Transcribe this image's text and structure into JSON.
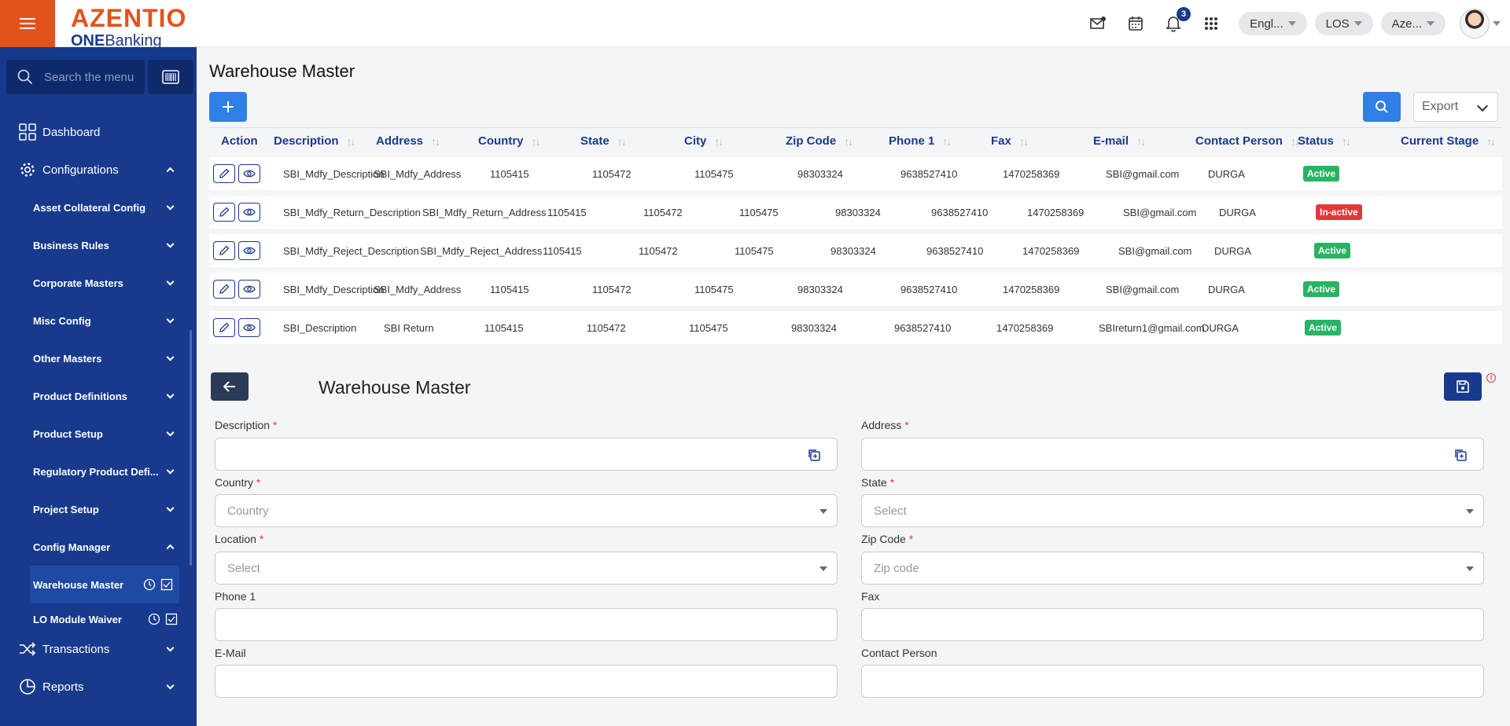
{
  "header": {
    "brand": "AZENTIO",
    "brand_sub_bold": "ONE",
    "brand_sub": "Banking",
    "notification_count": "3",
    "language": "Engl...",
    "module": "LOS",
    "org": "Aze..."
  },
  "sidebar": {
    "search_placeholder": "Search the menu",
    "dashboard": "Dashboard",
    "configurations": "Configurations",
    "submenus": [
      "Asset Collateral Config",
      "Business Rules",
      "Corporate Masters",
      "Misc Config",
      "Other Masters",
      "Product Definitions",
      "Product Setup",
      "Regulatory Product Defi...",
      "Project Setup"
    ],
    "config_manager": "Config Manager",
    "active_leaf": "Warehouse Master",
    "next_leaf": "LO Module Waiver",
    "transactions": "Transactions",
    "reports": "Reports"
  },
  "page": {
    "title": "Warehouse Master",
    "export_label": "Export"
  },
  "table": {
    "headers": [
      "Action",
      "Description",
      "Address",
      "Country",
      "State",
      "City",
      "Zip Code",
      "Phone 1",
      "Fax",
      "E-mail",
      "Contact Person",
      "Status",
      "Current Stage"
    ],
    "rows": [
      [
        "SBI_Mdfy_Description",
        "SBI_Mdfy_Address",
        "1105415",
        "1105472",
        "1105475",
        "98303324",
        "9638527410",
        "1470258369",
        "SBI@gmail.com",
        "DURGA",
        "Active"
      ],
      [
        "SBI_Mdfy_Return_Description",
        "SBI_Mdfy_Return_Address",
        "1105415",
        "1105472",
        "1105475",
        "98303324",
        "9638527410",
        "1470258369",
        "SBI@gmail.com",
        "DURGA",
        "In-active"
      ],
      [
        "SBI_Mdfy_Reject_Description",
        "SBI_Mdfy_Reject_Address",
        "1105415",
        "1105472",
        "1105475",
        "98303324",
        "9638527410",
        "1470258369",
        "SBI@gmail.com",
        "DURGA",
        "Active"
      ],
      [
        "SBI_Mdfy_Description",
        "SBI_Mdfy_Address",
        "1105415",
        "1105472",
        "1105475",
        "98303324",
        "9638527410",
        "1470258369",
        "SBI@gmail.com",
        "DURGA",
        "Active"
      ],
      [
        "SBI_Description",
        "SBI Return",
        "1105415",
        "1105472",
        "1105475",
        "98303324",
        "9638527410",
        "1470258369",
        "SBIreturn1@gmail.com",
        "DURGA",
        "Active"
      ]
    ]
  },
  "form": {
    "title": "Warehouse Master",
    "description_label": "Description",
    "address_label": "Address",
    "country_label": "Country",
    "country_placeholder": "Country",
    "state_label": "State",
    "state_placeholder": "Select",
    "location_label": "Location",
    "location_placeholder": "Select",
    "zip_label": "Zip Code",
    "zip_placeholder": "Zip code",
    "phone_label": "Phone 1",
    "fax_label": "Fax",
    "email_label": "E-Mail",
    "contact_label": "Contact Person",
    "required_mark": "*",
    "warn_mark": "!"
  },
  "colors": {
    "brand_orange": "#e2531b",
    "sidebar_blue": "#173a8c",
    "primary_button": "#2f7fe6",
    "status_active": "#27b463",
    "status_inactive": "#e5373b"
  }
}
